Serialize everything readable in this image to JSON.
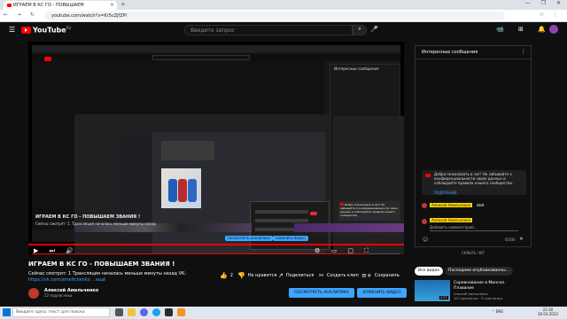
{
  "browser": {
    "tab_title": "ИГРАЕМ В КС ГО - ПОВЫШАЕМ",
    "url": "youtube.com/watch?v=Kr5cZjfZPl",
    "nav_icons": "← → ↻",
    "ext_icons": "☆ ⋮",
    "win_controls": "— ❐ ✕",
    "tab_close": "×",
    "new_tab": "+"
  },
  "yt": {
    "menu_icon": "☰",
    "logo_text": "YouTube",
    "logo_country": "RU",
    "search_placeholder": "Введите запрос",
    "search_icon": "⌕",
    "mic_icon": "🎤",
    "header_icons": "📹 ⊞ 🔔"
  },
  "player": {
    "controls_left": "▶ ⏭ 🔊",
    "controls_right": "⚙ ▭ ▢ ⛶",
    "inner_title": "ИГРАЕМ В КС ГО - ПОВЫШАЕМ ЗВАНИЯ !",
    "inner_desc": "Сейчас смотрят: 1. Трансляция началась меньше минуты назад",
    "inner_btn1": "ПОСМОТРЕТЬ АНАЛИТИКУ",
    "inner_btn2": "ИЗМЕНИТЬ ВИДЕО",
    "inner_chat_title": "Интересные сообщения",
    "inner_chat_msg": "Добро пожаловать в чат! Не забывайте о конфиденциальности своих данных и соблюдайте правила нашего сообщества.",
    "inner_chat_link": "ПОДРОБНЕЕ"
  },
  "video": {
    "title": "ИГРАЕМ В КС ГО - ПОВЫШАЕМ ЗВАНИЯ !",
    "desc_line1": "Сейчас смотрят: 1  Трансляция началась меньше минуты назад  VK:",
    "desc_line2": "https://vk.com/amelfchenko   ...ещё",
    "channel": "Алексей Амельченко",
    "subscribers": "22 подписчика",
    "likes": "2",
    "dislike_label": "Не нравится",
    "share_label": "Поделиться",
    "clip_label": "Создать клип",
    "save_label": "Сохранить",
    "more_label": "...",
    "analytics_btn": "ПОСМОТРЕТЬ АНАЛИТИКУ",
    "edit_btn": "ИЗМЕНИТЬ ВИДЕО"
  },
  "chat": {
    "title": "Интересные сообщения",
    "menu_icon": "⋮",
    "notice": "Добро пожаловать в чат! Не забывайте о конфиденциальности своих данных и соблюдайте правила нашего сообщества.",
    "notice_link": "ПОДРОБНЕЕ",
    "msg_name": "Алексей Амельченко",
    "msg_text": "dwd",
    "input_name": "Алексей Амельченко",
    "input_placeholder": "Добавить комментарий...",
    "emoji_icon": "☺",
    "char_count": "0/200",
    "send_icon": "➤",
    "hide_label": "СКРЫТЬ ЧАТ"
  },
  "side": {
    "chip_all": "Все видео",
    "chip_recent": "Последние опубликованны...",
    "rec_title": "Соревнование в Минске. Плавание",
    "rec_channel": "Алексей Амельченко",
    "rec_meta": "103 просмотра · 3 года назад",
    "rec_duration": "2:57"
  },
  "taskbar": {
    "search_placeholder": "Введите здесь текст для поиска",
    "tray": "⌃ ENG",
    "time": "22:30",
    "date": "30.03.2022"
  }
}
